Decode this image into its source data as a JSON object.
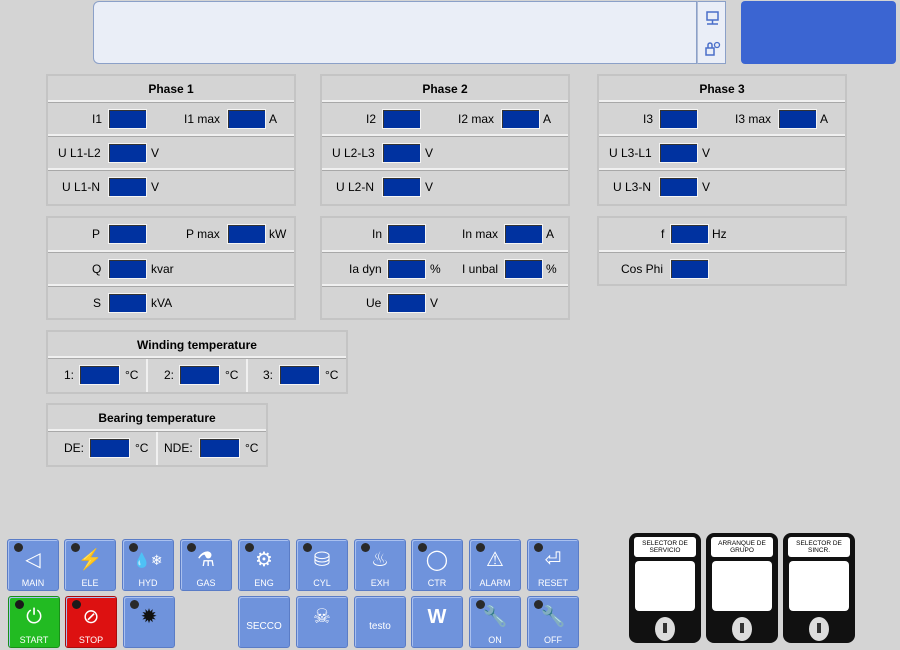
{
  "header": {
    "status_text": ""
  },
  "phase1": {
    "title": "Phase 1",
    "i_label": "I1",
    "imax_label": "I1 max",
    "i_unit": "A",
    "u1_label": "U L1-L2",
    "u1_unit": "V",
    "u2_label": "U L1-N",
    "u2_unit": "V"
  },
  "phase2": {
    "title": "Phase 2",
    "i_label": "I2",
    "imax_label": "I2 max",
    "i_unit": "A",
    "u1_label": "U L2-L3",
    "u1_unit": "V",
    "u2_label": "U L2-N",
    "u2_unit": "V"
  },
  "phase3": {
    "title": "Phase 3",
    "i_label": "I3",
    "imax_label": "I3 max",
    "i_unit": "A",
    "u1_label": "U L3-L1",
    "u1_unit": "V",
    "u2_label": "U L3-N",
    "u2_unit": "V"
  },
  "power": {
    "p_label": "P",
    "pmax_label": "P max",
    "p_unit": "kW",
    "q_label": "Q",
    "q_unit": "kvar",
    "s_label": "S",
    "s_unit": "kVA"
  },
  "neutral": {
    "in_label": "In",
    "inmax_label": "In max",
    "in_unit": "A",
    "iadyn_label": "Ia dyn",
    "iadyn_unit": "%",
    "iunbal_label": "I unbal",
    "iunbal_unit": "%",
    "ue_label": "Ue",
    "ue_unit": "V"
  },
  "freq": {
    "f_label": "f",
    "f_unit": "Hz",
    "cos_label": "Cos Phi"
  },
  "winding": {
    "title": "Winding temperature",
    "c1_label": "1:",
    "c2_label": "2:",
    "c3_label": "3:",
    "unit": "°C"
  },
  "bearing": {
    "title": "Bearing temperature",
    "de_label": "DE:",
    "nde_label": "NDE:",
    "unit": "°C"
  },
  "nav": {
    "main": "MAIN",
    "ele": "ELE",
    "hyd": "HYD",
    "gas": "GAS",
    "eng": "ENG",
    "cyl": "CYL",
    "exh": "EXH",
    "ctr": "CTR",
    "alarm": "ALARM",
    "reset": "RESET",
    "start": "START",
    "stop": "STOP",
    "secco": "SECCO",
    "testo": "testo",
    "on": "ON",
    "off": "OFF"
  },
  "selectors": [
    {
      "label": "SELECTOR DE SERVICIO"
    },
    {
      "label": "ARRANQUE DE GRUPO"
    },
    {
      "label": "SELECTOR DE SINCR."
    }
  ],
  "colors": {
    "value_box": "#0032a0",
    "button": "#6f93dc",
    "accent": "#3b65d2",
    "start": "#22bb22",
    "stop": "#dd1111"
  }
}
